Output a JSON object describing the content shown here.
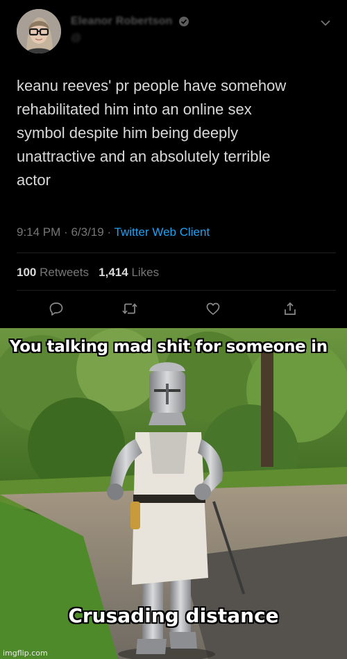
{
  "tweet": {
    "author_name": "Eleanor Robertson",
    "handle": "@",
    "text_lines": [
      "keanu reeves' pr people have somehow",
      "rehabilitated him into an online sex",
      "symbol despite him being deeply",
      "unattractive and an absolutely terrible",
      "actor"
    ],
    "time": "9:14 PM",
    "date": "6/3/19",
    "separator": "·",
    "client": "Twitter Web Client",
    "retweets_count": "100",
    "retweets_label": "Retweets",
    "likes_count": "1,414",
    "likes_label": "Likes",
    "icons": {
      "verified": "verified-badge-icon",
      "more": "chevron-down-icon",
      "reply": "reply-icon",
      "retweet": "retweet-icon",
      "like": "heart-icon",
      "share": "share-icon"
    }
  },
  "meme": {
    "top_caption": "You talking mad shit for someone in",
    "bottom_caption": "Crusading distance",
    "watermark": "imgflip.com"
  },
  "colors": {
    "background": "#000000",
    "text": "#d9d9d9",
    "muted": "#767676",
    "link": "#1da1f2"
  }
}
